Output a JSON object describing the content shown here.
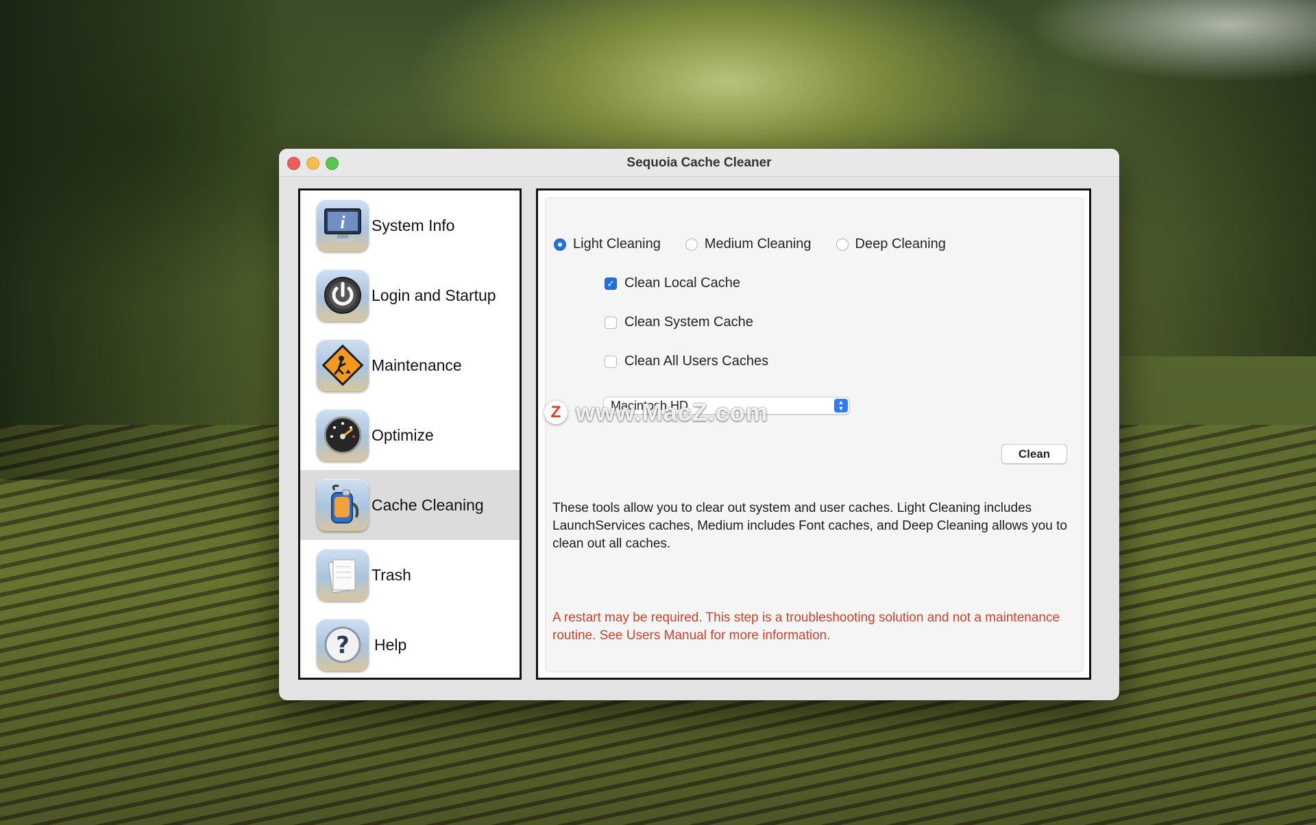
{
  "window": {
    "title": "Sequoia Cache Cleaner"
  },
  "sidebar": {
    "items": [
      {
        "label": "System Info",
        "icon": "info-monitor-icon"
      },
      {
        "label": "Login and Startup",
        "icon": "power-icon"
      },
      {
        "label": "Maintenance",
        "icon": "construction-sign-icon"
      },
      {
        "label": "Optimize",
        "icon": "gauge-icon"
      },
      {
        "label": "Cache Cleaning",
        "icon": "vacuum-cleaner-icon",
        "selected": true
      },
      {
        "label": "Trash",
        "icon": "trash-papers-icon"
      },
      {
        "label": "Help",
        "icon": "question-icon"
      }
    ]
  },
  "cleaning": {
    "modes": [
      {
        "label": "Light Cleaning",
        "selected": true
      },
      {
        "label": "Medium Cleaning",
        "selected": false
      },
      {
        "label": "Deep Cleaning",
        "selected": false
      }
    ],
    "options": [
      {
        "label": "Clean Local Cache",
        "checked": true
      },
      {
        "label": "Clean System Cache",
        "checked": false
      },
      {
        "label": "Clean All Users Caches",
        "checked": false
      }
    ],
    "volume_select": {
      "value": "Macintosh HD"
    },
    "clean_button": "Clean",
    "description": "These tools allow you to clear out system and user caches.  Light Cleaning includes LaunchServices caches, Medium includes Font caches, and Deep Cleaning allows you to clean out all caches.",
    "warning": "A restart may be required.  This step is a troubleshooting solution and not a maintenance routine.  See Users Manual for more information."
  },
  "watermark": {
    "logo": "Z",
    "text": "www.MacZ.com"
  },
  "colors": {
    "accent": "#1f6fe0",
    "warning": "#d0412b",
    "selected_row": "#dcdcdc"
  }
}
